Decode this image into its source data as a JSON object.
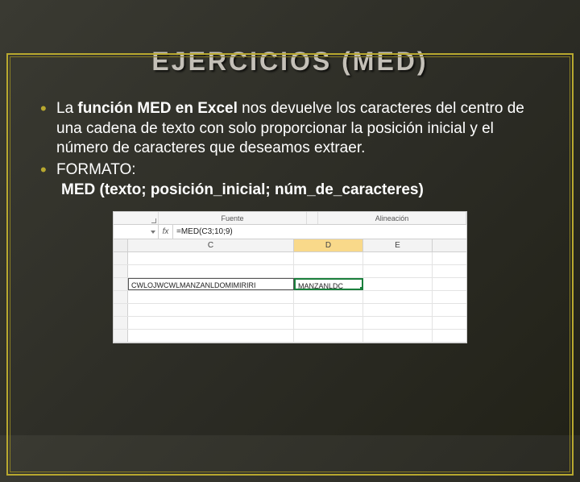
{
  "title": "EJERCICIOS (MED)",
  "bullets": {
    "b1_prefix": "La ",
    "b1_bold": "función MED en Excel",
    "b1_rest": " nos devuelve los caracteres del centro de una cadena de texto con solo proporcionar la posición inicial y el número de caracteres que deseamos extraer.",
    "b2_label": "FORMATO:",
    "b2_format": "MED (texto; posición_inicial; núm_de_caracteres)"
  },
  "excel": {
    "ribbon_left": "Fuente",
    "ribbon_right": "Alineación",
    "namebox": "",
    "fx": "fx",
    "formula": "=MED(C3;10;9)",
    "cols": {
      "c": "C",
      "d": "D",
      "e": "E"
    },
    "rows": {
      "r1": "",
      "r2": "",
      "r3_c": "CWLOJWCWLMANZANLDOMIMIRIRI",
      "r3_d": "MANZANLDC"
    }
  }
}
